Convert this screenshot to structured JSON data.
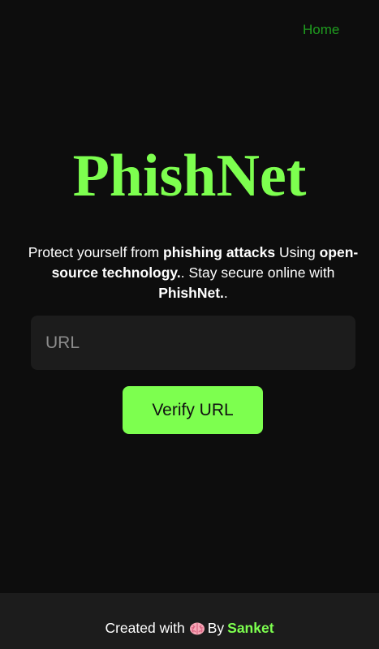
{
  "nav": {
    "home_label": "Home"
  },
  "hero": {
    "title": "PhishNet",
    "tagline": {
      "part1": "Protect yourself from ",
      "bold1": "phishing attacks",
      "part2": " Using ",
      "bold2": "open-source technology.",
      "part3": ". Stay secure online with ",
      "bold3": "PhishNet.",
      "part4": "."
    }
  },
  "form": {
    "url_placeholder": "URL",
    "url_value": "",
    "verify_label": "Verify URL"
  },
  "footer": {
    "created_with": "Created with",
    "icon": "brain-icon",
    "by": "By",
    "author": "Sanket"
  },
  "colors": {
    "accent": "#7dff4f",
    "nav_link": "#1f9d1f",
    "background": "#0d0d0d",
    "panel": "#1c1c1c",
    "text": "#ffffff"
  }
}
